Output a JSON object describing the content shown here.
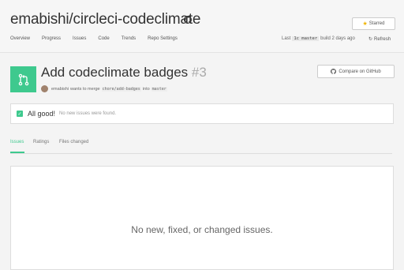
{
  "repo": {
    "title": "emabishi/circleci-codeclimate",
    "starred_label": "Starred"
  },
  "nav": [
    "Overview",
    "Progress",
    "Issues",
    "Code",
    "Trends",
    "Repo Settings"
  ],
  "status": {
    "prefix": "Last",
    "commit": "1c master",
    "suffix": "build 2 days ago",
    "refresh_label": "Refresh"
  },
  "pr": {
    "title": "Add codeclimate badges",
    "number": "#3",
    "author": "emabishi",
    "merge_text": "wants to merge",
    "source_branch": "chore/add-badges",
    "into": "into",
    "target_branch": "master",
    "compare_label": "Compare on GitHub"
  },
  "summary": {
    "title": "All good!",
    "subtitle": "No new issues were found."
  },
  "tabs": [
    "Issues",
    "Ratings",
    "Files changed"
  ],
  "empty_message": "No new, fixed, or changed issues.",
  "colors": {
    "accent": "#3ec98e",
    "star": "#f0b400"
  }
}
